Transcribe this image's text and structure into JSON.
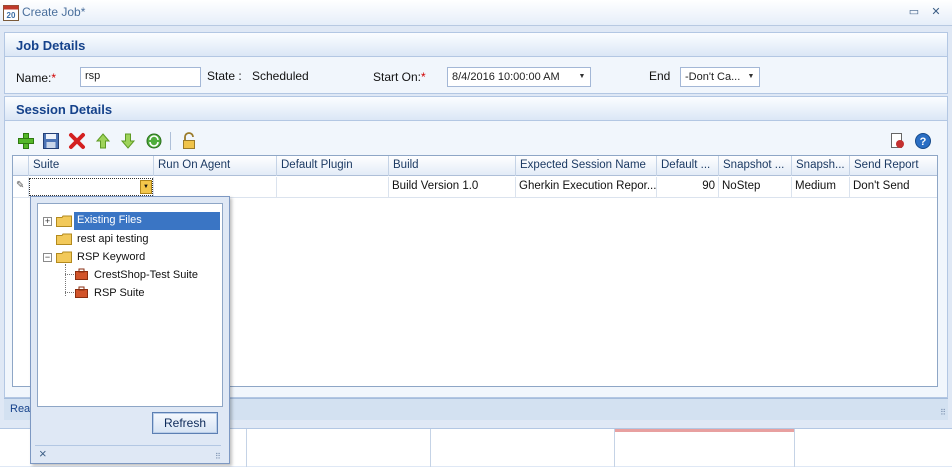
{
  "window": {
    "title": "Create Job*",
    "app_icon": "calendar-icon",
    "restore_icon": "restore-icon",
    "close_icon": "close-icon"
  },
  "job_details": {
    "header": "Job Details",
    "name_label": "Name:",
    "required_mark": "*",
    "name_value": "rsp",
    "state_label": "State :",
    "state_value": "Scheduled",
    "start_on_label": "Start On:",
    "start_on_value": "8/4/2016 10:00:00 AM",
    "end_label": "End",
    "end_value": "-Don't Ca..."
  },
  "session_details": {
    "header": "Session Details",
    "toolbar": [
      "add-icon",
      "save-icon",
      "delete-icon",
      "move-up-icon",
      "move-down-icon",
      "refresh-icon",
      "unlock-icon"
    ],
    "toolbar_right": [
      "export-icon",
      "help-icon"
    ]
  },
  "grid": {
    "columns": [
      "Suite",
      "Run On Agent",
      "Default Plugin",
      "Build",
      "Expected Session Name",
      "Default ...",
      "Snapshot ...",
      "Snapsh...",
      "Send Report"
    ],
    "rows": [
      {
        "suite": "",
        "run_on_agent": "",
        "default_plugin": "",
        "build": "Build Version 1.0",
        "expected_session_name": "Gherkin Execution Repor...",
        "default": "90",
        "snapshot": "NoStep",
        "snapsh": "Medium",
        "send_report": "Don't Send"
      }
    ]
  },
  "tree": {
    "nodes": [
      {
        "label": "Existing Files",
        "expander": "+",
        "selected": true,
        "type": "folder"
      },
      {
        "label": "rest api testing",
        "type": "folder"
      },
      {
        "label": "RSP Keyword",
        "expander": "−",
        "type": "folder"
      },
      {
        "label": "CrestShop-Test Suite",
        "type": "suite"
      },
      {
        "label": "RSP Suite",
        "type": "suite"
      }
    ],
    "refresh_label": "Refresh",
    "close_glyph": "×"
  },
  "status": {
    "text": "Rea"
  },
  "colors": {
    "accent": "#15428b",
    "selection": "#3a75c4",
    "required": "#d00000"
  }
}
